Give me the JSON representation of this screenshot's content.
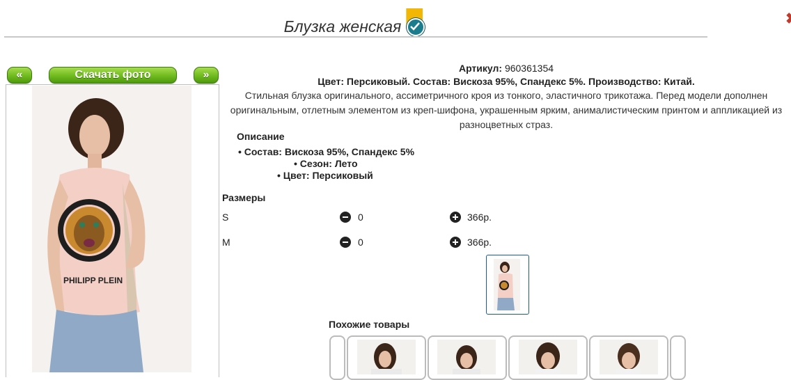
{
  "header": {
    "title": "Блузка женская",
    "badge_icon": "verified-check-icon"
  },
  "gallery": {
    "prev_label": "«",
    "download_label": "Скачать фото",
    "next_label": "»"
  },
  "product": {
    "article_label": "Артикул:",
    "article_value": "960361354",
    "spec_line": "Цвет: Персиковый. Состав: Вискоза 95%, Спандекс 5%. Производство: Китай.",
    "description": "Стильная блузка оригинального, ассиметричного кроя из тонкого, эластичного трикотажа. Перед модели дополнен оригинальным, отлетным элементом из креп-шифона, украшенным ярким, анималистическим принтом и аппликацией из разноцветных страз.",
    "desc_heading": "Описание",
    "attributes": [
      "Состав: Вискоза 95%, Спандекс 5%",
      "Сезон: Лето",
      "Цвет: Персиковый"
    ]
  },
  "sizes": {
    "heading": "Размеры",
    "rows": [
      {
        "size": "S",
        "qty": "0",
        "price": "366р."
      },
      {
        "size": "M",
        "qty": "0",
        "price": "366р."
      }
    ]
  },
  "similar": {
    "heading": "Похожие товары"
  },
  "colors": {
    "accent_green": "#6fba1e",
    "badge_gold": "#f2b705",
    "badge_teal": "#1a7c8c",
    "close_red": "#c0392b"
  }
}
